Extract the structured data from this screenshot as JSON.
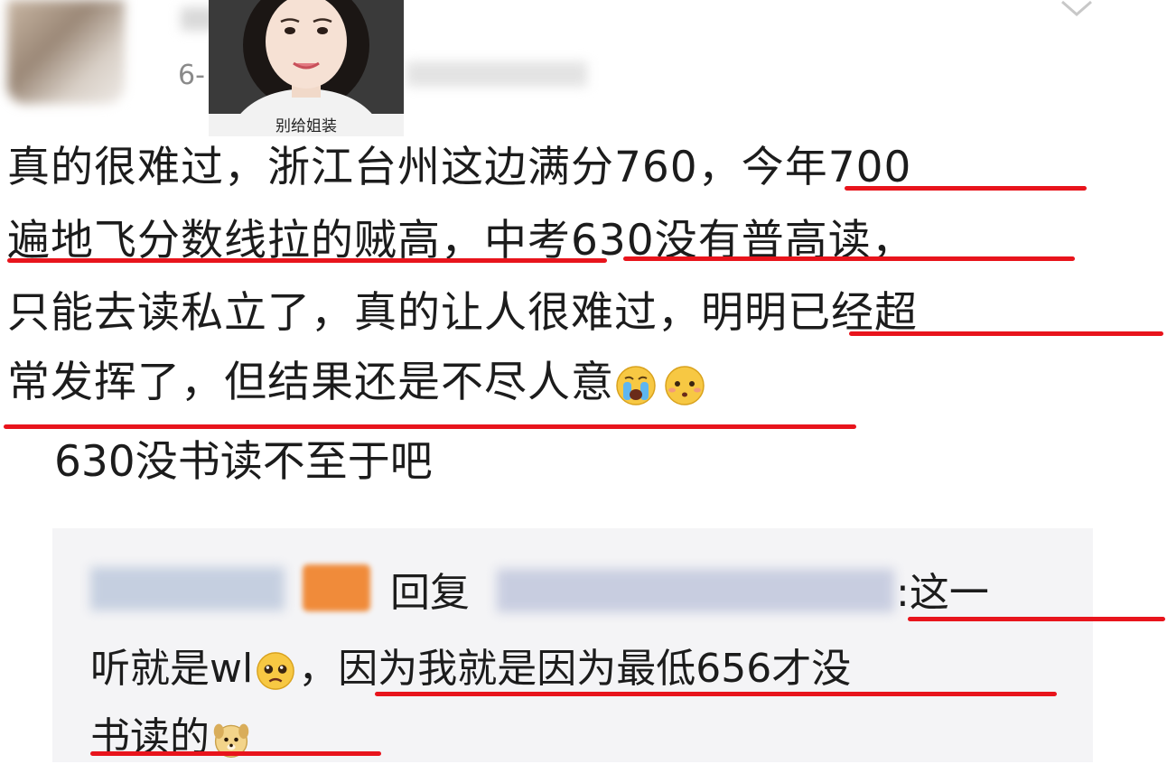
{
  "header": {
    "date_prefix": "6-",
    "photo_caption": "别给姐装"
  },
  "comment": {
    "lines": [
      "真的很难过，浙江台州这边满分760，今年700",
      "遍地飞分数线拉的贼高，中考630没有普高读，",
      "只能去读私立了，真的让人很难过，明明已经超",
      "常发挥了，但结果还是不尽人意"
    ],
    "end_emojis": [
      "crying-face",
      "pleading-face"
    ]
  },
  "reply": {
    "text": "630没书读不至于吧"
  },
  "sub_reply": {
    "reply_word": "回复",
    "line1_tail": ":这一",
    "line2": "听就是wl",
    "line2_tail": "，因为我就是因为最低656才没",
    "line3": "书读的",
    "emojis": [
      "pleading-face",
      "dog-face"
    ]
  },
  "colors": {
    "underline": "#e8141c",
    "reply_bg": "#f4f4f6",
    "text": "#1c1c1c"
  }
}
